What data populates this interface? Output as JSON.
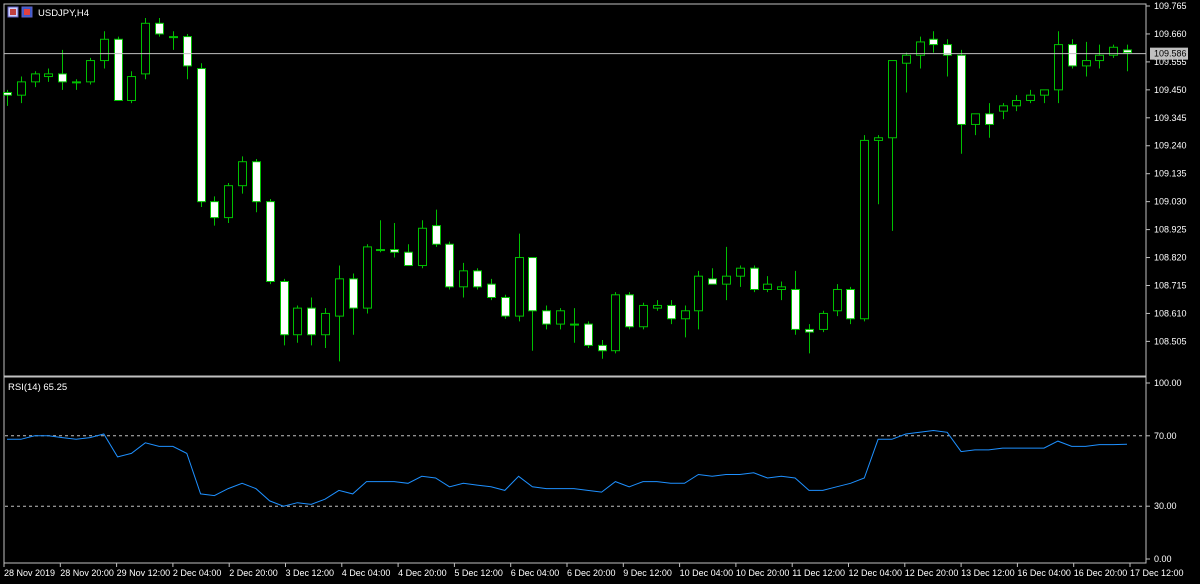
{
  "chart_header": {
    "symbol_label": "USDJPY,H4",
    "rsi_label": "RSI(14) 65.25"
  },
  "colors": {
    "background": "#000000",
    "border": "#c0c0c0",
    "bull_wick": "#00c000",
    "bull_body": "#000000",
    "bear_body": "#ffffff",
    "rsi_line": "#1e90ff",
    "bid_line": "#c0c0c0",
    "price_tag_bg": "#c0c0c0"
  },
  "chart_data": [
    {
      "type": "candlestick",
      "title": "USDJPY,H4",
      "ylim": [
        108.39,
        109.765
      ],
      "y_ticks": [
        "109.765",
        "109.660",
        "109.555",
        "109.450",
        "109.345",
        "109.240",
        "109.135",
        "109.030",
        "108.925",
        "108.820",
        "108.715",
        "108.610",
        "108.505"
      ],
      "current_price": "109.586",
      "ohlc": [
        [
          109.44,
          109.45,
          109.39,
          109.43
        ],
        [
          109.43,
          109.5,
          109.4,
          109.48
        ],
        [
          109.48,
          109.52,
          109.46,
          109.51
        ],
        [
          109.5,
          109.53,
          109.48,
          109.51
        ],
        [
          109.51,
          109.6,
          109.45,
          109.48
        ],
        [
          109.48,
          109.49,
          109.45,
          109.48
        ],
        [
          109.48,
          109.57,
          109.47,
          109.56
        ],
        [
          109.56,
          109.67,
          109.53,
          109.64
        ],
        [
          109.64,
          109.65,
          109.41,
          109.41
        ],
        [
          109.41,
          109.52,
          109.4,
          109.5
        ],
        [
          109.51,
          109.72,
          109.49,
          109.7
        ],
        [
          109.7,
          109.72,
          109.65,
          109.66
        ],
        [
          109.65,
          109.67,
          109.6,
          109.65
        ],
        [
          109.65,
          109.66,
          109.49,
          109.54
        ],
        [
          109.53,
          109.55,
          109.01,
          109.03
        ],
        [
          109.03,
          109.05,
          108.94,
          108.97
        ],
        [
          108.97,
          109.1,
          108.95,
          109.09
        ],
        [
          109.09,
          109.2,
          109.06,
          109.18
        ],
        [
          109.18,
          109.19,
          108.99,
          109.03
        ],
        [
          109.03,
          109.04,
          108.72,
          108.73
        ],
        [
          108.73,
          108.74,
          108.49,
          108.53
        ],
        [
          108.53,
          108.64,
          108.5,
          108.63
        ],
        [
          108.63,
          108.67,
          108.49,
          108.53
        ],
        [
          108.53,
          108.63,
          108.48,
          108.61
        ],
        [
          108.6,
          108.79,
          108.43,
          108.74
        ],
        [
          108.74,
          108.76,
          108.53,
          108.63
        ],
        [
          108.63,
          108.87,
          108.61,
          108.86
        ],
        [
          108.85,
          108.96,
          108.84,
          108.85
        ],
        [
          108.85,
          108.95,
          108.82,
          108.84
        ],
        [
          108.84,
          108.87,
          108.79,
          108.79
        ],
        [
          108.79,
          108.96,
          108.78,
          108.93
        ],
        [
          108.94,
          109.0,
          108.86,
          108.87
        ],
        [
          108.87,
          108.88,
          108.7,
          108.71
        ],
        [
          108.71,
          108.8,
          108.67,
          108.77
        ],
        [
          108.77,
          108.78,
          108.7,
          108.71
        ],
        [
          108.72,
          108.74,
          108.66,
          108.67
        ],
        [
          108.67,
          108.68,
          108.59,
          108.6
        ],
        [
          108.6,
          108.91,
          108.58,
          108.82
        ],
        [
          108.82,
          108.82,
          108.47,
          108.62
        ],
        [
          108.62,
          108.64,
          108.55,
          108.57
        ],
        [
          108.57,
          108.63,
          108.55,
          108.62
        ],
        [
          108.57,
          108.63,
          108.5,
          108.57
        ],
        [
          108.57,
          108.58,
          108.48,
          108.49
        ],
        [
          108.49,
          108.51,
          108.44,
          108.47
        ],
        [
          108.47,
          108.69,
          108.46,
          108.68
        ],
        [
          108.68,
          108.69,
          108.55,
          108.56
        ],
        [
          108.56,
          108.65,
          108.55,
          108.64
        ],
        [
          108.63,
          108.66,
          108.62,
          108.64
        ],
        [
          108.64,
          108.66,
          108.57,
          108.59
        ],
        [
          108.59,
          108.64,
          108.52,
          108.62
        ],
        [
          108.62,
          108.77,
          108.55,
          108.75
        ],
        [
          108.74,
          108.78,
          108.72,
          108.72
        ],
        [
          108.72,
          108.86,
          108.66,
          108.75
        ],
        [
          108.75,
          108.79,
          108.71,
          108.78
        ],
        [
          108.78,
          108.79,
          108.69,
          108.7
        ],
        [
          108.7,
          108.75,
          108.69,
          108.72
        ],
        [
          108.7,
          108.73,
          108.66,
          108.71
        ],
        [
          108.7,
          108.77,
          108.53,
          108.55
        ],
        [
          108.55,
          108.57,
          108.46,
          108.54
        ],
        [
          108.55,
          108.62,
          108.54,
          108.61
        ],
        [
          108.62,
          108.72,
          108.6,
          108.7
        ],
        [
          108.7,
          108.71,
          108.57,
          108.59
        ],
        [
          108.59,
          109.28,
          108.58,
          109.26
        ],
        [
          109.26,
          109.28,
          109.02,
          109.27
        ],
        [
          109.27,
          109.46,
          108.92,
          109.56
        ],
        [
          109.55,
          109.59,
          109.44,
          109.58
        ],
        [
          109.58,
          109.65,
          109.53,
          109.63
        ],
        [
          109.64,
          109.67,
          109.59,
          109.62
        ],
        [
          109.62,
          109.64,
          109.5,
          109.58
        ],
        [
          109.58,
          109.6,
          109.21,
          109.32
        ],
        [
          109.32,
          109.35,
          109.28,
          109.36
        ],
        [
          109.36,
          109.4,
          109.27,
          109.32
        ],
        [
          109.37,
          109.4,
          109.34,
          109.39
        ],
        [
          109.39,
          109.43,
          109.37,
          109.41
        ],
        [
          109.41,
          109.45,
          109.4,
          109.43
        ],
        [
          109.43,
          109.45,
          109.4,
          109.45
        ],
        [
          109.45,
          109.67,
          109.4,
          109.62
        ],
        [
          109.62,
          109.64,
          109.53,
          109.54
        ],
        [
          109.54,
          109.63,
          109.5,
          109.56
        ],
        [
          109.56,
          109.62,
          109.53,
          109.58
        ],
        [
          109.58,
          109.62,
          109.57,
          109.61
        ],
        [
          109.6,
          109.62,
          109.52,
          109.59
        ]
      ]
    },
    {
      "type": "line",
      "title": "RSI(14) 65.25",
      "ylim": [
        0,
        100
      ],
      "y_ticks": [
        "100.00",
        "70.00",
        "30.00",
        "0.00"
      ],
      "levels": [
        70,
        30
      ],
      "values": [
        68,
        68,
        70,
        70,
        69,
        68,
        69,
        71,
        58,
        60,
        66,
        64,
        64,
        60,
        37,
        36,
        40,
        43,
        40,
        33,
        30,
        32,
        31,
        34,
        39,
        37,
        44,
        44,
        44,
        43,
        47,
        46,
        41,
        43,
        42,
        41,
        39,
        47,
        41,
        40,
        40,
        40,
        39,
        38,
        44,
        41,
        44,
        44,
        43,
        43,
        48,
        47,
        48,
        48,
        49,
        46,
        47,
        46,
        39,
        39,
        41,
        43,
        46,
        68,
        68,
        71,
        72,
        73,
        72,
        61,
        62,
        62,
        63,
        63,
        63,
        63,
        67,
        64,
        64,
        65,
        65,
        65.25
      ]
    }
  ],
  "x_axis": {
    "labels": [
      "28 Nov 2019",
      "28 Nov 20:00",
      "29 Nov 12:00",
      "2 Dec 04:00",
      "2 Dec 20:00",
      "3 Dec 12:00",
      "4 Dec 04:00",
      "4 Dec 20:00",
      "5 Dec 12:00",
      "6 Dec 04:00",
      "6 Dec 20:00",
      "9 Dec 12:00",
      "10 Dec 04:00",
      "10 Dec 20:00",
      "11 Dec 12:00",
      "12 Dec 04:00",
      "12 Dec 20:00",
      "13 Dec 12:00",
      "16 Dec 04:00",
      "16 Dec 20:00",
      "17 Dec 12:00"
    ]
  }
}
